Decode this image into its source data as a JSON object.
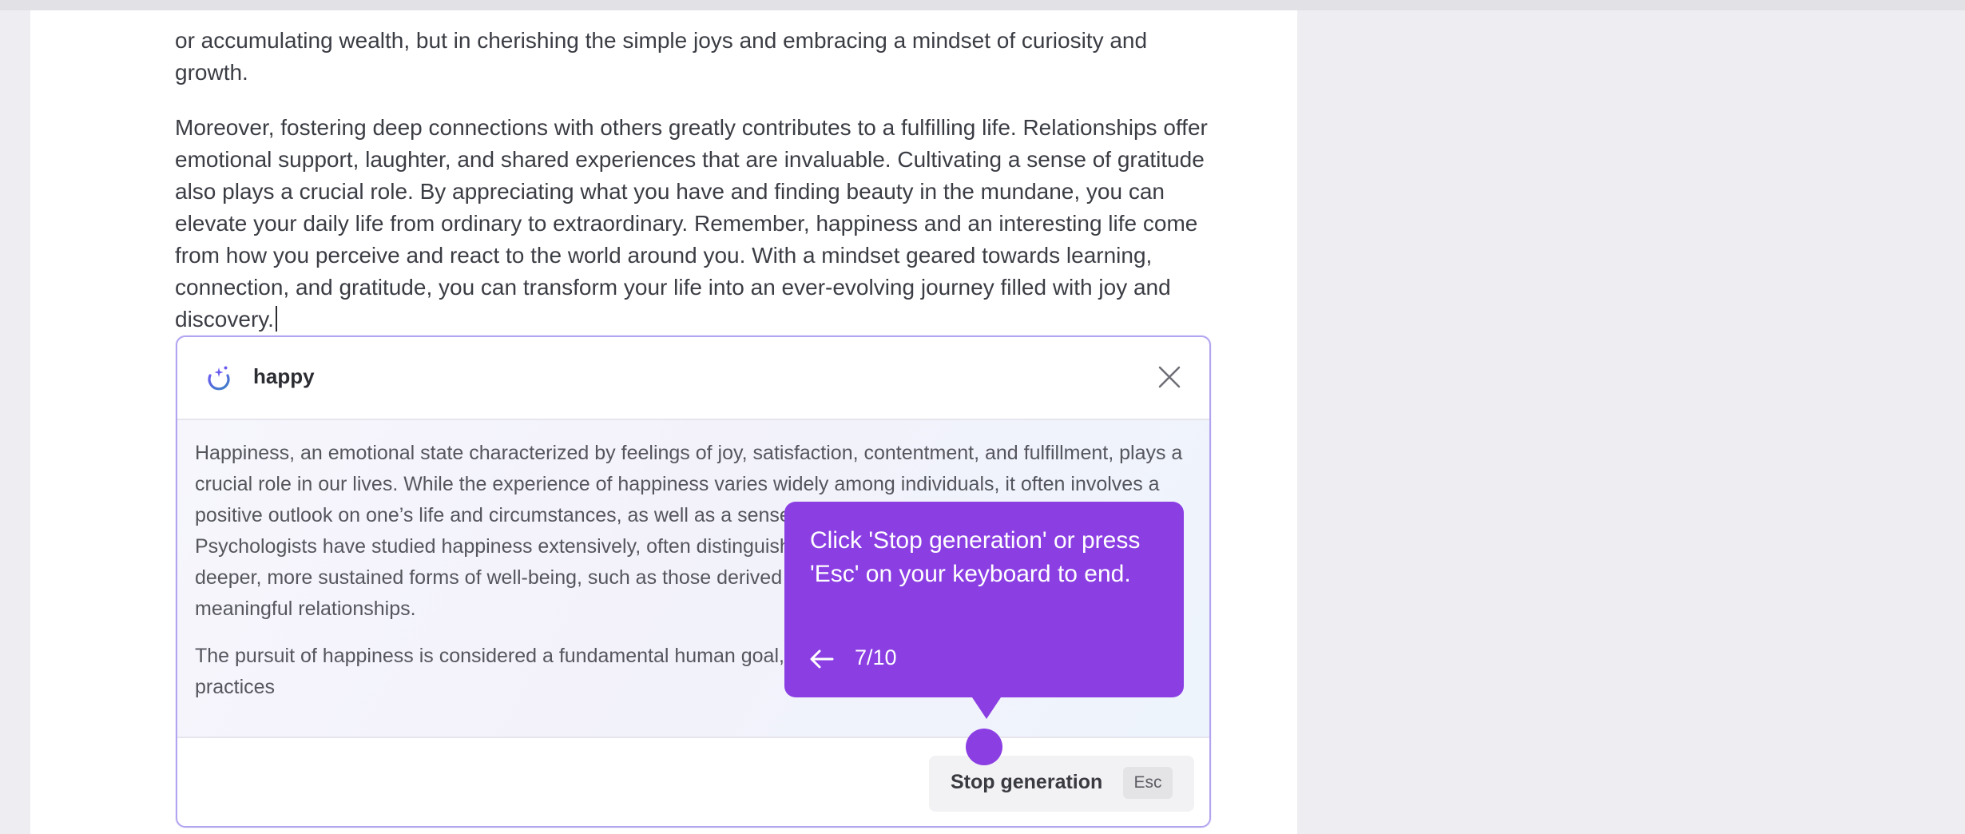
{
  "document": {
    "paragraph_1": "or accumulating wealth, but in cherishing the simple joys and embracing a mindset of curiosity and growth.",
    "paragraph_2": "Moreover, fostering deep connections with others greatly contributes to a fulfilling life. Relationships offer emotional support, laughter, and shared experiences that are invaluable. Cultivating a sense of gratitude also plays a crucial role. By appreciating what you have and finding beauty in the mundane, you can elevate your daily life from ordinary to extraordinary. Remember, happiness and an interesting life come from how you perceive and react to the world around you. With a mindset geared towards learning, connection, and gratitude, you can transform your life into an ever-evolving journey filled with joy and discovery."
  },
  "ai_panel": {
    "title": "happy",
    "header_icon": "magic-write-icon",
    "close_icon": "close-icon",
    "generated_paragraph_1": "Happiness, an emotional state characterized by feelings of joy, satisfaction, contentment, and fulfillment, plays a crucial role in our lives. While the experience of happiness varies widely among individuals, it often involves a positive outlook on one’s life and circumstances, as well as a sense that one's life is meaningful and worthwhile. Psychologists have studied happiness extensively, often distinguishing between momentary pleasures and deeper, more sustained forms of well-being, such as those derived from achieving one's life goals or fostering meaningful relationships.",
    "generated_paragraph_2": "The pursuit of happiness is considered a fundamental human goal, shaped by cultural, social, and individual practices",
    "stop_button_label": "Stop generation",
    "stop_shortcut": "Esc"
  },
  "tooltip": {
    "text": "Click 'Stop generation' or press 'Esc' on your keyboard to end.",
    "back_icon": "arrow-left-icon",
    "step": "7/10"
  },
  "colors": {
    "accent": "#8b3fe3",
    "panel_border": "#b3a4f0",
    "page_bg": "#eeedf1"
  }
}
